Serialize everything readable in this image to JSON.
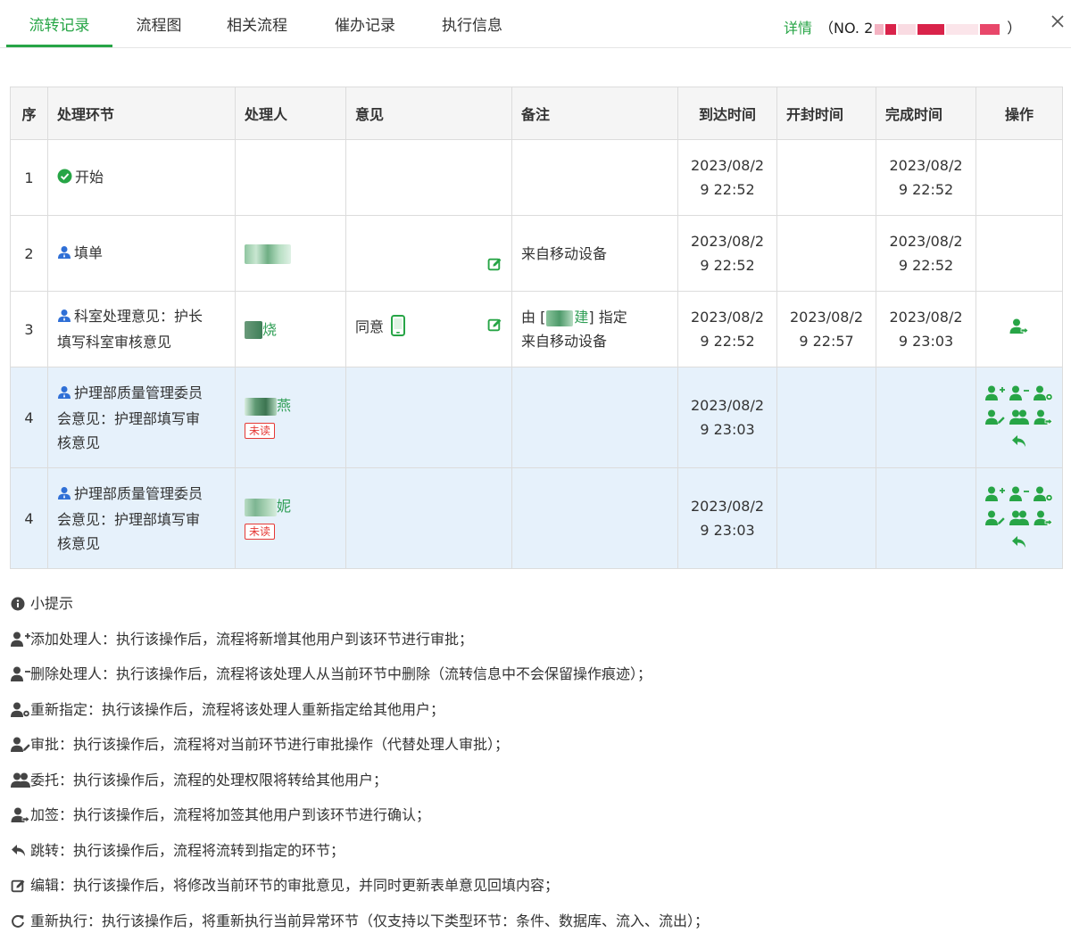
{
  "tabs": [
    "流转记录",
    "流程图",
    "相关流程",
    "催办记录",
    "执行信息"
  ],
  "active_tab": "流转记录",
  "detail": {
    "label": "详情",
    "number": "（NO. 2",
    "suffix": "）"
  },
  "table": {
    "headers": [
      "序",
      "处理环节",
      "处理人",
      "意见",
      "备注",
      "到达时间",
      "开封时间",
      "完成时间",
      "操作"
    ],
    "rows": [
      {
        "seq": "1",
        "step": "开始",
        "handler": "",
        "opinion": "",
        "note": "",
        "arrive_a": "2023/08/2",
        "arrive_b": "9 22:52",
        "open_a": "",
        "open_b": "",
        "done_a": "2023/08/2",
        "done_b": "9 22:52"
      },
      {
        "seq": "2",
        "step": "填单",
        "handler": "",
        "opinion": "",
        "note": "来自移动设备",
        "arrive_a": "2023/08/2",
        "arrive_b": "9 22:52",
        "open_a": "",
        "open_b": "",
        "done_a": "2023/08/2",
        "done_b": "9 22:52"
      },
      {
        "seq": "3",
        "step_a": "科室处理意见：护长",
        "step_b": "填写科室审核意见",
        "handler_tail": "烧",
        "opinion": "同意",
        "note_a": "由 [",
        "note_mid": "建",
        "note_b": "] 指定",
        "note_c": "来自移动设备",
        "arrive_a": "2023/08/2",
        "arrive_b": "9 22:52",
        "open_a": "2023/08/2",
        "open_b": "9 22:57",
        "done_a": "2023/08/2",
        "done_b": "9 23:03"
      },
      {
        "seq": "4",
        "step_a": "护理部质量管理委员",
        "step_b": "会意见：护理部填写审",
        "step_c": "核意见",
        "handler_tail": "燕",
        "unread": "未读",
        "arrive_a": "2023/08/2",
        "arrive_b": "9 23:03"
      },
      {
        "seq": "4",
        "step_a": "护理部质量管理委员",
        "step_b": "会意见：护理部填写审",
        "step_c": "核意见",
        "handler_tail": "妮",
        "unread": "未读",
        "arrive_a": "2023/08/2",
        "arrive_b": "9 23:03"
      }
    ]
  },
  "tips": {
    "title": "小提示",
    "items": [
      {
        "icon": "user-plus-icon",
        "text": "添加处理人：执行该操作后，流程将新增其他用户到该环节进行审批；"
      },
      {
        "icon": "user-minus-icon",
        "text": "删除处理人：执行该操作后，流程将该处理人从当前环节中删除（流转信息中不会保留操作痕迹）；"
      },
      {
        "icon": "user-cog-icon",
        "text": "重新指定：执行该操作后，流程将该处理人重新指定给其他用户；"
      },
      {
        "icon": "user-edit-icon",
        "text": "审批：执行该操作后，流程将对当前环节进行审批操作（代替处理人审批）；"
      },
      {
        "icon": "users-icon",
        "text": "委托：执行该操作后，流程的处理权限将转给其他用户；"
      },
      {
        "icon": "user-add-sign-icon",
        "text": "加签：执行该操作后，流程将加签其他用户到该环节进行确认；"
      },
      {
        "icon": "reply-icon",
        "text": "跳转：执行该操作后，流程将流转到指定的环节；"
      },
      {
        "icon": "edit-icon",
        "text": "编辑：执行该操作后，将修改当前环节的审批意见，并同时更新表单意见回填内容；"
      },
      {
        "icon": "refresh-icon",
        "text": "重新执行：执行该操作后，将重新执行当前异常环节（仅支持以下类型环节：条件、数据库、流入、流出）；"
      }
    ]
  },
  "colors": {
    "accent": "#27a546",
    "user_icon": "#2f6fd6",
    "row_highlight": "#e6f1fb",
    "unread": "#e53935"
  }
}
